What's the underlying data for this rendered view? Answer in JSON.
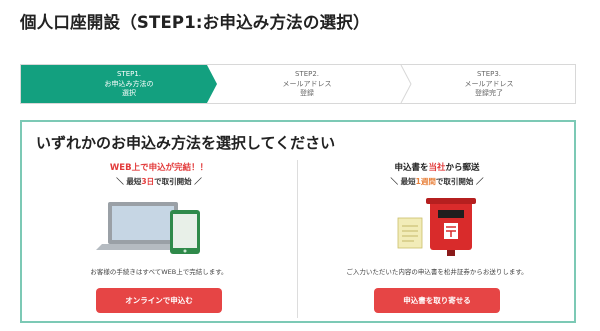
{
  "page": {
    "title": "個人口座開設（STEP1:お申込み方法の選択）"
  },
  "steps": [
    {
      "number": "STEP1.",
      "line1": "お申込み方法の",
      "line2": "選択"
    },
    {
      "number": "STEP2.",
      "line1": "メールアドレス",
      "line2": "登録"
    },
    {
      "number": "STEP3.",
      "line1": "メールアドレス",
      "line2": "登録完了"
    }
  ],
  "panel": {
    "heading": "いずれかのお申込み方法を選択してください"
  },
  "online": {
    "tagline": "WEB上で申込が完結！！",
    "speed_prefix": "＼ 最短",
    "speed_highlight": "3日",
    "speed_suffix": "で取引開始 ／",
    "note": "お客様の手続きはすべてWEB上で完結します。",
    "button_label": "オンラインで申込む"
  },
  "mail": {
    "tagline_prefix": "申込書を",
    "tagline_highlight": "当社",
    "tagline_suffix": "から郵送",
    "speed_prefix": "＼ 最短",
    "speed_highlight": "1週間",
    "speed_suffix": "で取引開始 ／",
    "note": "ご入力いただいた内容の申込書を松井証券からお送りします。",
    "button_label": "申込書を取り寄せる"
  },
  "colors": {
    "step_active": "#13a07f",
    "panel_border": "#7cc9b5",
    "button": "#e64545",
    "highlight_red": "#e23a3a",
    "highlight_orange": "#e8803a"
  }
}
